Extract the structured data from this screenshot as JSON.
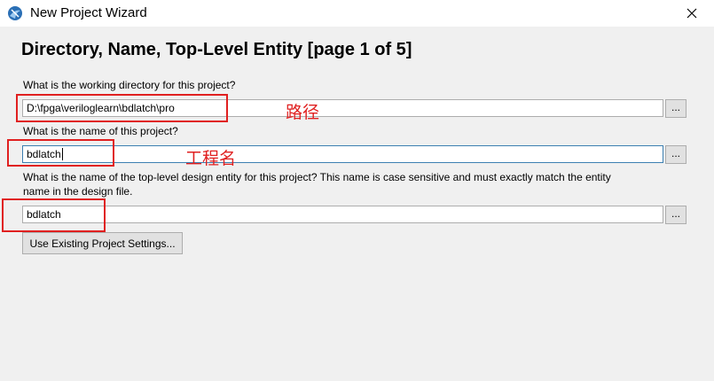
{
  "window": {
    "title": "New Project Wizard"
  },
  "page": {
    "heading": "Directory, Name, Top-Level Entity [page 1 of 5]"
  },
  "fields": {
    "directory": {
      "label": "What is the working directory for this project?",
      "value": "D:\\fpga\\veriloglearn\\bdlatch\\pro",
      "browse_label": "..."
    },
    "project_name": {
      "label": "What is the name of this project?",
      "value": "bdlatch",
      "browse_label": "..."
    },
    "top_entity": {
      "label_line1": "What is the name of the top-level design entity for this project? This name is case sensitive and must exactly match the entity",
      "label_line2": "name in the design file.",
      "value": "bdlatch",
      "browse_label": "..."
    }
  },
  "buttons": {
    "use_existing": "Use Existing Project Settings..."
  },
  "annotations": {
    "path": "路径",
    "project": "工程名"
  },
  "colors": {
    "highlight": "#e02020",
    "focus_border": "#3c7fb1"
  }
}
